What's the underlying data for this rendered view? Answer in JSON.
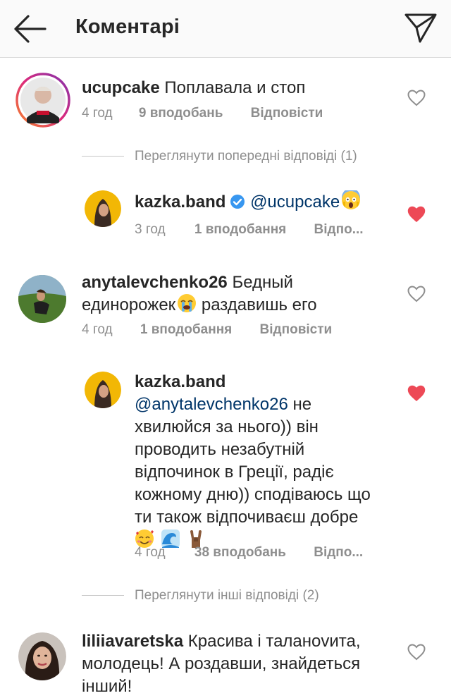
{
  "header": {
    "title": "Коментарі"
  },
  "comments": [
    {
      "username": "ucupcake",
      "text": "Поплавала и стоп",
      "time": "4 год",
      "likes": "9 вподобань",
      "reply": "Відповісти",
      "liked": false
    },
    {
      "view_replies": "Переглянути попередні відповіді (1)"
    },
    {
      "username": "kazka.band",
      "mention": "@ucupcake",
      "time": "3 год",
      "likes": "1 вподобання",
      "reply": "Відпо...",
      "liked": true
    },
    {
      "username": "anytalevchenko26",
      "text_line1": "Бедный",
      "text_line2a": "единорожек",
      "text_line2b": "раздавишь его",
      "time": "4 год",
      "likes": "1 вподобання",
      "reply": "Відповісти",
      "liked": false
    },
    {
      "username": "kazka.band",
      "mention": "@anytalevchenko26",
      "text_line1": "не",
      "text_line2": "хвилюйся за нього)) він",
      "text_line3": "проводить незабутній",
      "text_line4": "відпочинок в Греції, радіє",
      "text_line5": "кожному дню)) сподіваюсь що",
      "text_line6": "ти також відпочиваєш добре",
      "time": "4 год",
      "likes": "38 вподобань",
      "reply": "Відпо...",
      "liked": true
    },
    {
      "view_replies": "Переглянути інші відповіді (2)"
    },
    {
      "username": "liliiavaretska",
      "text_line1": "Красива і таланоvита,",
      "text_line2": "молодець! А роздавши, знайдеться",
      "text_line3": "інший!",
      "liked": false
    }
  ],
  "colors": {
    "liked_heart": "#ed4956",
    "verified": "#3897f0",
    "mention": "#003569",
    "meta": "#8e8e8e"
  }
}
